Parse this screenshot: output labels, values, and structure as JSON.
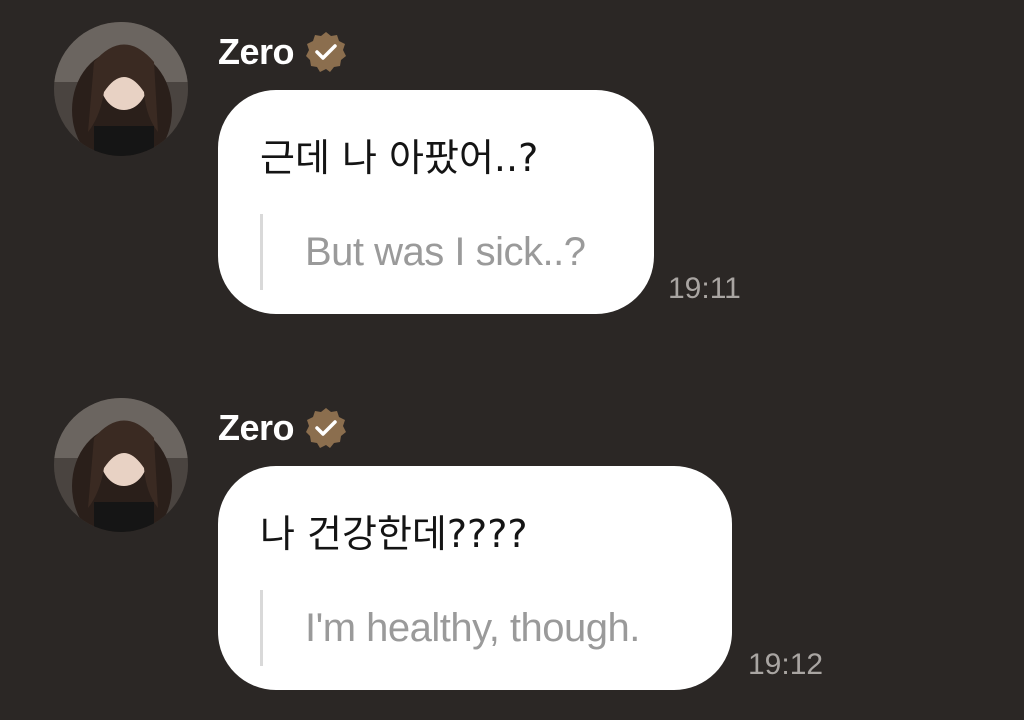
{
  "messages": [
    {
      "sender": "Zero",
      "verified": true,
      "text": "근데 나 아팠어..?",
      "translation": "But was I sick..?",
      "time": "19:11",
      "avatar_icon": "profile-photo"
    },
    {
      "sender": "Zero",
      "verified": true,
      "text": "나 건강한데????",
      "translation": "I'm healthy, though.",
      "time": "19:12",
      "avatar_icon": "profile-photo"
    }
  ],
  "colors": {
    "background": "#2b2725",
    "bubble": "#ffffff",
    "verified_badge": "#8b6e4e",
    "timestamp": "#a9a5a2",
    "translation_text": "#9a9a9a"
  }
}
